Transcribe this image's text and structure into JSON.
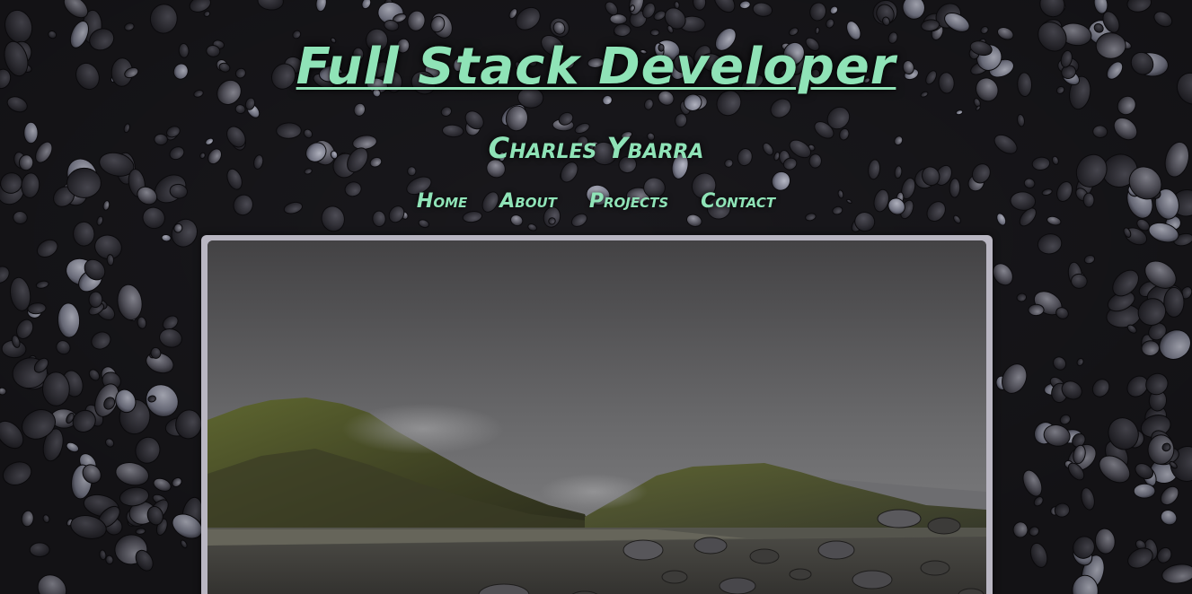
{
  "header": {
    "title": "Full Stack Developer",
    "name": "Charles Ybarra"
  },
  "nav": {
    "items": [
      {
        "label": "Home"
      },
      {
        "label": "About"
      },
      {
        "label": "Projects"
      },
      {
        "label": "Contact"
      }
    ]
  },
  "colors": {
    "accent": "#8fe3b7",
    "frame": "#b9b6c2",
    "background": "#1a191c"
  },
  "hero": {
    "image_alt": "Misty mountain landscape with rocky shore"
  }
}
